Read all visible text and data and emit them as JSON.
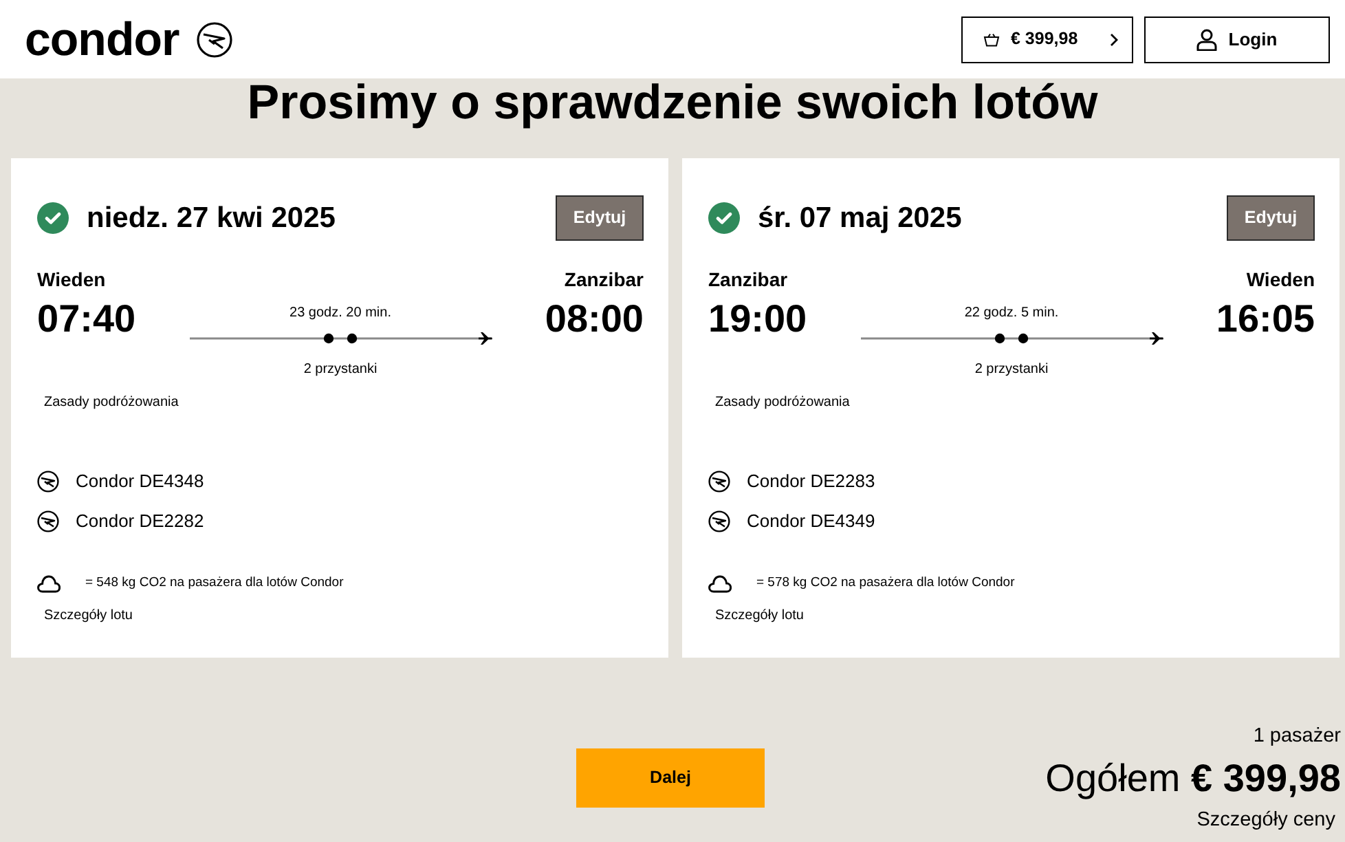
{
  "header": {
    "logo": "condor",
    "cart_total": "€ 399,98",
    "login": "Login"
  },
  "title": "Prosimy o sprawdzenie swoich lotów",
  "flights": [
    {
      "confirmed": true,
      "date": "niedz. 27 kwi 2025",
      "edit": "Edytuj",
      "origin": "Wieden",
      "destination": "Zanzibar",
      "departure": "07:40",
      "arrival": "08:00",
      "duration": "23 godz. 20 min.",
      "stops_label": "2 przystanki",
      "travel_rules": "Zasady podróżowania",
      "segments": [
        "Condor DE4348",
        "Condor DE2282"
      ],
      "co2": "= 548 kg CO2 na pasażera dla lotów Condor",
      "details": "Szczegóły lotu"
    },
    {
      "confirmed": true,
      "date": "śr. 07 maj 2025",
      "edit": "Edytuj",
      "origin": "Zanzibar",
      "destination": "Wieden",
      "departure": "19:00",
      "arrival": "16:05",
      "duration": "22 godz. 5 min.",
      "stops_label": "2 przystanki",
      "travel_rules": "Zasady podróżowania",
      "segments": [
        "Condor DE2283",
        "Condor DE4349"
      ],
      "co2": "= 578 kg CO2 na pasażera dla lotów Condor",
      "details": "Szczegóły lotu"
    }
  ],
  "footer": {
    "continue": "Dalej",
    "passengers": "1 pasażer",
    "total": "Ogółem **€ 399,98**",
    "price_details": "Szczegóły ceny"
  }
}
